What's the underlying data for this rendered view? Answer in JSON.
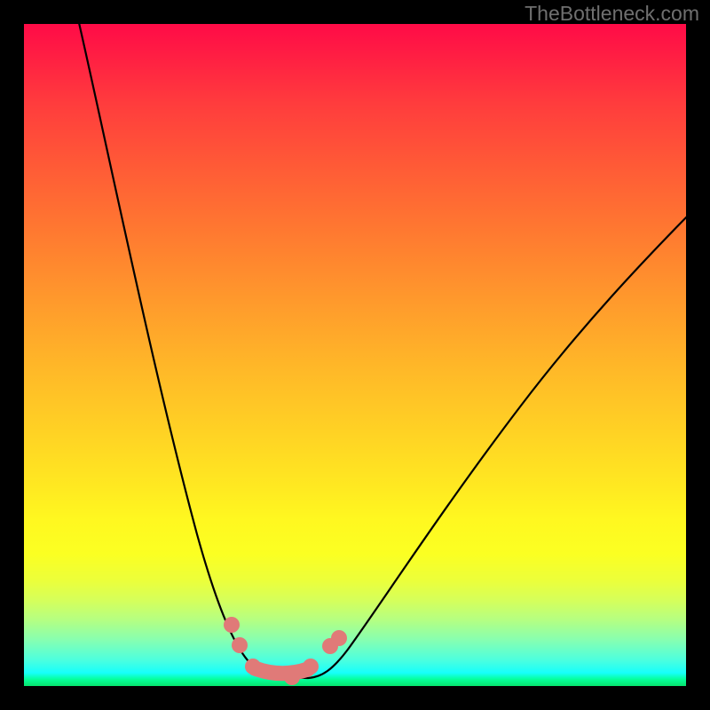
{
  "watermark": "TheBottleneck.com",
  "chart_data": {
    "type": "line",
    "title": "",
    "xlabel": "",
    "ylabel": "",
    "xlim": [
      0,
      1
    ],
    "ylim": [
      0,
      1
    ],
    "series": [
      {
        "name": "curve",
        "x": [
          0.08,
          0.12,
          0.18,
          0.24,
          0.28,
          0.32,
          0.34,
          0.38,
          0.4,
          0.43,
          0.49,
          0.6,
          0.75,
          0.9,
          1.0
        ],
        "y": [
          1.02,
          0.84,
          0.48,
          0.23,
          0.11,
          0.04,
          0.02,
          0.01,
          0.01,
          0.02,
          0.06,
          0.2,
          0.42,
          0.6,
          0.71
        ]
      }
    ],
    "markers": {
      "name": "highlight-points",
      "x": [
        0.314,
        0.326,
        0.346,
        0.405,
        0.433,
        0.462,
        0.476
      ],
      "y": [
        0.093,
        0.062,
        0.03,
        0.013,
        0.03,
        0.06,
        0.072
      ],
      "color": "#e07a78"
    },
    "flat_segment": {
      "x": [
        0.349,
        0.429
      ],
      "y": [
        0.015,
        0.015
      ],
      "color": "#e07a78"
    },
    "background": {
      "type": "vertical-gradient",
      "stops": [
        {
          "pos": 0.0,
          "color": "#ff0b47"
        },
        {
          "pos": 0.5,
          "color": "#ffb828"
        },
        {
          "pos": 0.8,
          "color": "#fbff22"
        },
        {
          "pos": 0.95,
          "color": "#4effdd"
        },
        {
          "pos": 1.0,
          "color": "#06e36e"
        }
      ]
    }
  }
}
